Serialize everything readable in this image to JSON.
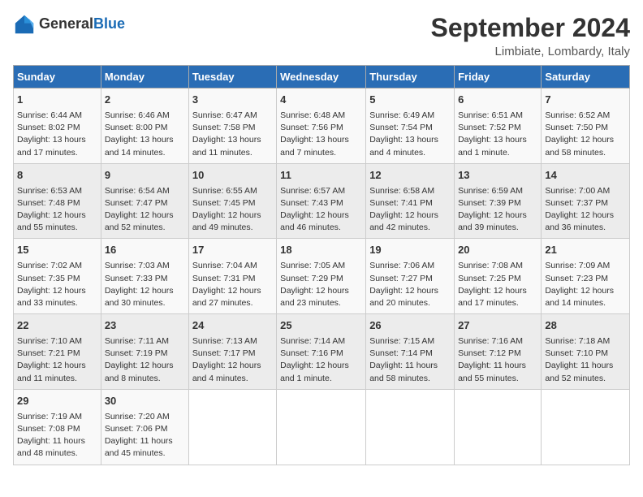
{
  "header": {
    "logo_general": "General",
    "logo_blue": "Blue",
    "month_title": "September 2024",
    "location": "Limbiate, Lombardy, Italy"
  },
  "days_of_week": [
    "Sunday",
    "Monday",
    "Tuesday",
    "Wednesday",
    "Thursday",
    "Friday",
    "Saturday"
  ],
  "weeks": [
    [
      {
        "day": "1",
        "sunrise": "Sunrise: 6:44 AM",
        "sunset": "Sunset: 8:02 PM",
        "daylight": "Daylight: 13 hours and 17 minutes."
      },
      {
        "day": "2",
        "sunrise": "Sunrise: 6:46 AM",
        "sunset": "Sunset: 8:00 PM",
        "daylight": "Daylight: 13 hours and 14 minutes."
      },
      {
        "day": "3",
        "sunrise": "Sunrise: 6:47 AM",
        "sunset": "Sunset: 7:58 PM",
        "daylight": "Daylight: 13 hours and 11 minutes."
      },
      {
        "day": "4",
        "sunrise": "Sunrise: 6:48 AM",
        "sunset": "Sunset: 7:56 PM",
        "daylight": "Daylight: 13 hours and 7 minutes."
      },
      {
        "day": "5",
        "sunrise": "Sunrise: 6:49 AM",
        "sunset": "Sunset: 7:54 PM",
        "daylight": "Daylight: 13 hours and 4 minutes."
      },
      {
        "day": "6",
        "sunrise": "Sunrise: 6:51 AM",
        "sunset": "Sunset: 7:52 PM",
        "daylight": "Daylight: 13 hours and 1 minute."
      },
      {
        "day": "7",
        "sunrise": "Sunrise: 6:52 AM",
        "sunset": "Sunset: 7:50 PM",
        "daylight": "Daylight: 12 hours and 58 minutes."
      }
    ],
    [
      {
        "day": "8",
        "sunrise": "Sunrise: 6:53 AM",
        "sunset": "Sunset: 7:48 PM",
        "daylight": "Daylight: 12 hours and 55 minutes."
      },
      {
        "day": "9",
        "sunrise": "Sunrise: 6:54 AM",
        "sunset": "Sunset: 7:47 PM",
        "daylight": "Daylight: 12 hours and 52 minutes."
      },
      {
        "day": "10",
        "sunrise": "Sunrise: 6:55 AM",
        "sunset": "Sunset: 7:45 PM",
        "daylight": "Daylight: 12 hours and 49 minutes."
      },
      {
        "day": "11",
        "sunrise": "Sunrise: 6:57 AM",
        "sunset": "Sunset: 7:43 PM",
        "daylight": "Daylight: 12 hours and 46 minutes."
      },
      {
        "day": "12",
        "sunrise": "Sunrise: 6:58 AM",
        "sunset": "Sunset: 7:41 PM",
        "daylight": "Daylight: 12 hours and 42 minutes."
      },
      {
        "day": "13",
        "sunrise": "Sunrise: 6:59 AM",
        "sunset": "Sunset: 7:39 PM",
        "daylight": "Daylight: 12 hours and 39 minutes."
      },
      {
        "day": "14",
        "sunrise": "Sunrise: 7:00 AM",
        "sunset": "Sunset: 7:37 PM",
        "daylight": "Daylight: 12 hours and 36 minutes."
      }
    ],
    [
      {
        "day": "15",
        "sunrise": "Sunrise: 7:02 AM",
        "sunset": "Sunset: 7:35 PM",
        "daylight": "Daylight: 12 hours and 33 minutes."
      },
      {
        "day": "16",
        "sunrise": "Sunrise: 7:03 AM",
        "sunset": "Sunset: 7:33 PM",
        "daylight": "Daylight: 12 hours and 30 minutes."
      },
      {
        "day": "17",
        "sunrise": "Sunrise: 7:04 AM",
        "sunset": "Sunset: 7:31 PM",
        "daylight": "Daylight: 12 hours and 27 minutes."
      },
      {
        "day": "18",
        "sunrise": "Sunrise: 7:05 AM",
        "sunset": "Sunset: 7:29 PM",
        "daylight": "Daylight: 12 hours and 23 minutes."
      },
      {
        "day": "19",
        "sunrise": "Sunrise: 7:06 AM",
        "sunset": "Sunset: 7:27 PM",
        "daylight": "Daylight: 12 hours and 20 minutes."
      },
      {
        "day": "20",
        "sunrise": "Sunrise: 7:08 AM",
        "sunset": "Sunset: 7:25 PM",
        "daylight": "Daylight: 12 hours and 17 minutes."
      },
      {
        "day": "21",
        "sunrise": "Sunrise: 7:09 AM",
        "sunset": "Sunset: 7:23 PM",
        "daylight": "Daylight: 12 hours and 14 minutes."
      }
    ],
    [
      {
        "day": "22",
        "sunrise": "Sunrise: 7:10 AM",
        "sunset": "Sunset: 7:21 PM",
        "daylight": "Daylight: 12 hours and 11 minutes."
      },
      {
        "day": "23",
        "sunrise": "Sunrise: 7:11 AM",
        "sunset": "Sunset: 7:19 PM",
        "daylight": "Daylight: 12 hours and 8 minutes."
      },
      {
        "day": "24",
        "sunrise": "Sunrise: 7:13 AM",
        "sunset": "Sunset: 7:17 PM",
        "daylight": "Daylight: 12 hours and 4 minutes."
      },
      {
        "day": "25",
        "sunrise": "Sunrise: 7:14 AM",
        "sunset": "Sunset: 7:16 PM",
        "daylight": "Daylight: 12 hours and 1 minute."
      },
      {
        "day": "26",
        "sunrise": "Sunrise: 7:15 AM",
        "sunset": "Sunset: 7:14 PM",
        "daylight": "Daylight: 11 hours and 58 minutes."
      },
      {
        "day": "27",
        "sunrise": "Sunrise: 7:16 AM",
        "sunset": "Sunset: 7:12 PM",
        "daylight": "Daylight: 11 hours and 55 minutes."
      },
      {
        "day": "28",
        "sunrise": "Sunrise: 7:18 AM",
        "sunset": "Sunset: 7:10 PM",
        "daylight": "Daylight: 11 hours and 52 minutes."
      }
    ],
    [
      {
        "day": "29",
        "sunrise": "Sunrise: 7:19 AM",
        "sunset": "Sunset: 7:08 PM",
        "daylight": "Daylight: 11 hours and 48 minutes."
      },
      {
        "day": "30",
        "sunrise": "Sunrise: 7:20 AM",
        "sunset": "Sunset: 7:06 PM",
        "daylight": "Daylight: 11 hours and 45 minutes."
      },
      null,
      null,
      null,
      null,
      null
    ]
  ]
}
